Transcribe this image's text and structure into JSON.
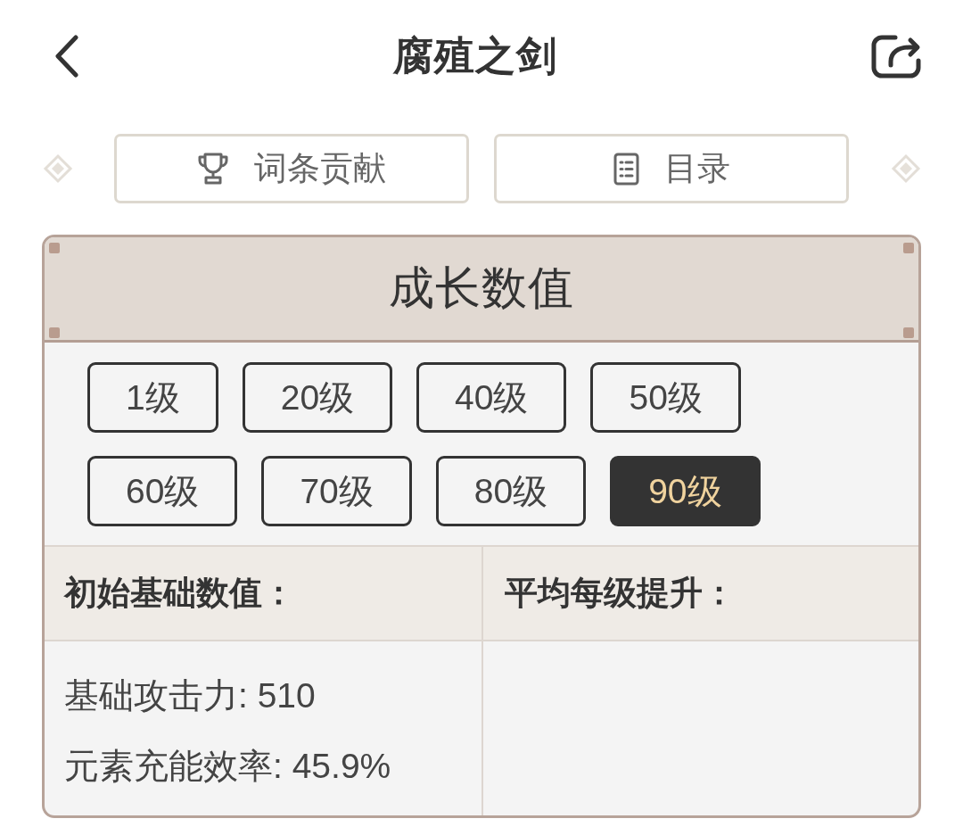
{
  "header": {
    "title": "腐殖之剑"
  },
  "nav_buttons": [
    {
      "label": "词条贡献"
    },
    {
      "label": "目录"
    }
  ],
  "card": {
    "title": "成长数值",
    "levels": [
      {
        "label": "1级",
        "selected": false
      },
      {
        "label": "20级",
        "selected": false
      },
      {
        "label": "40级",
        "selected": false
      },
      {
        "label": "50级",
        "selected": false
      },
      {
        "label": "60级",
        "selected": false
      },
      {
        "label": "70级",
        "selected": false
      },
      {
        "label": "80级",
        "selected": false
      },
      {
        "label": "90级",
        "selected": true
      }
    ],
    "table": {
      "columns": [
        "初始基础数值：",
        "平均每级提升："
      ],
      "rows": [
        {
          "cells": [
            [
              "基础攻击力: 510",
              "元素充能效率: 45.9%"
            ]
          ]
        }
      ]
    }
  }
}
